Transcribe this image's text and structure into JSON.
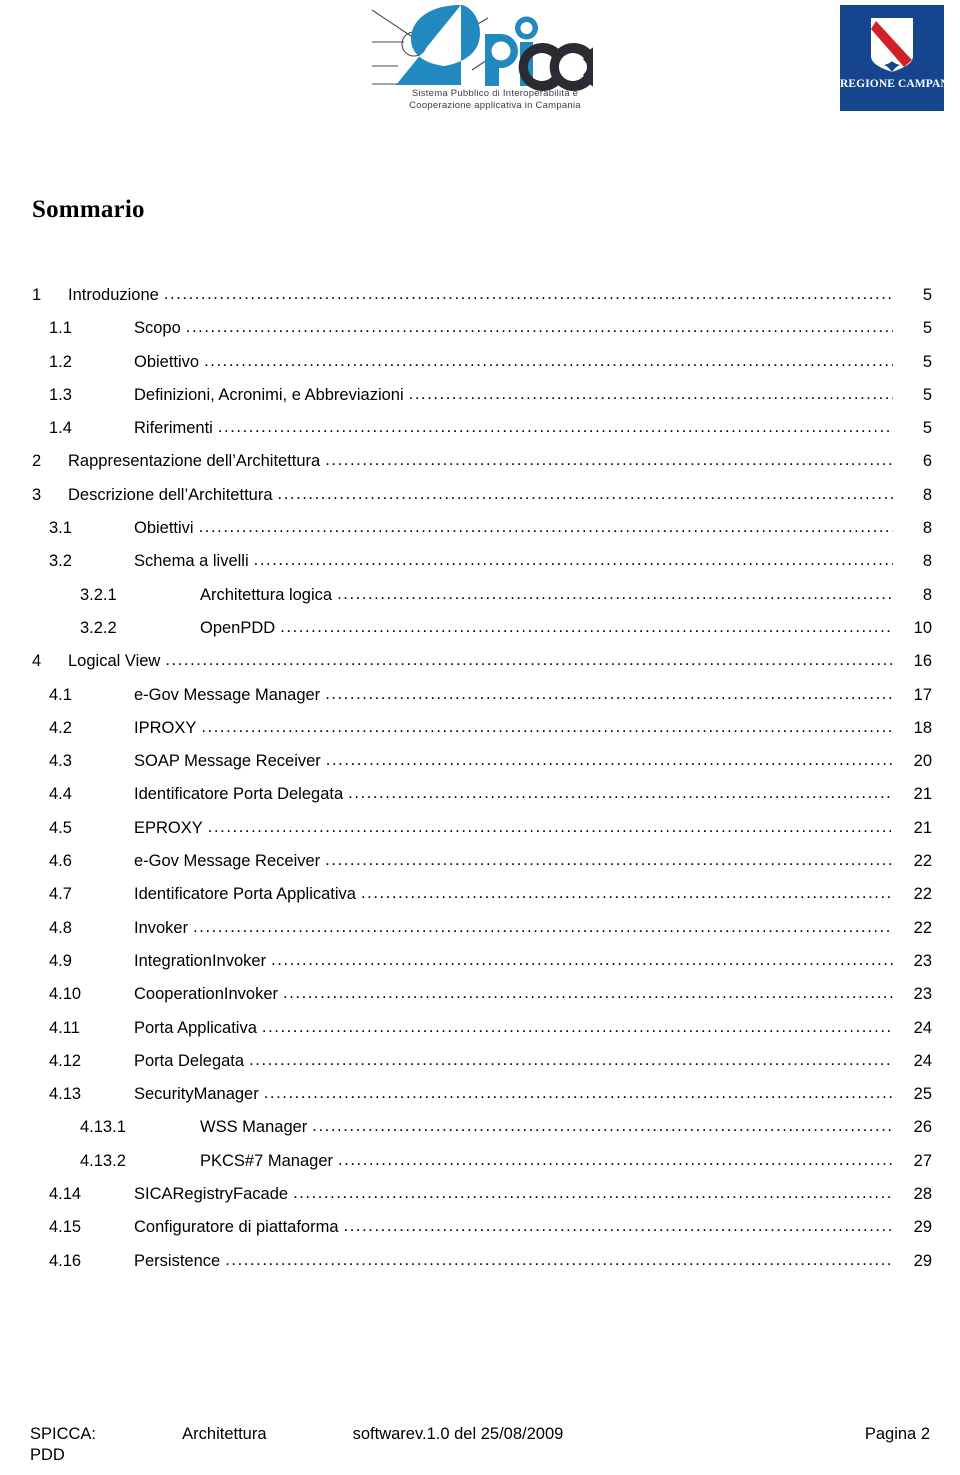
{
  "header": {
    "spicca_logo": {
      "icon": "spicca-logo-icon",
      "wordmark": "SPICCA",
      "tagline_line1": "Sistema Pubblico di Interoperabilità e",
      "tagline_line2": "Cooperazione applicativa in Campania",
      "brand_blue": "#2288c0",
      "text_color": "#3c3c48"
    },
    "campania_logo": {
      "icon": "regione-campania-logo-icon",
      "name": "REGIONE CAMPANIA",
      "box_blue": "#15458c",
      "stripe_red": "#d02028"
    }
  },
  "page_title": "Sommario",
  "toc": {
    "entries": [
      {
        "level": 1,
        "num": "1",
        "label": "Introduzione",
        "page": "5"
      },
      {
        "level": 2,
        "num": "1.1",
        "label": "Scopo",
        "page": "5"
      },
      {
        "level": 2,
        "num": "1.2",
        "label": "Obiettivo",
        "page": "5"
      },
      {
        "level": 2,
        "num": "1.3",
        "label": "Definizioni, Acronimi, e Abbreviazioni",
        "page": "5"
      },
      {
        "level": 2,
        "num": "1.4",
        "label": "Riferimenti",
        "page": "5"
      },
      {
        "level": 1,
        "num": "2",
        "label": "Rappresentazione dell’Architettura",
        "page": "6"
      },
      {
        "level": 1,
        "num": "3",
        "label": "Descrizione dell’Architettura",
        "page": "8"
      },
      {
        "level": 2,
        "num": "3.1",
        "label": "Obiettivi",
        "page": "8"
      },
      {
        "level": 2,
        "num": "3.2",
        "label": "Schema a livelli",
        "page": "8"
      },
      {
        "level": 3,
        "num": "3.2.1",
        "label": "Architettura logica",
        "page": "8"
      },
      {
        "level": 3,
        "num": "3.2.2",
        "label": "OpenPDD",
        "page": "10"
      },
      {
        "level": 1,
        "num": "4",
        "label": "Logical View",
        "page": "16"
      },
      {
        "level": 2,
        "num": "4.1",
        "label": "e-Gov Message Manager",
        "page": "17"
      },
      {
        "level": 2,
        "num": "4.2",
        "label": "IPROXY",
        "page": "18"
      },
      {
        "level": 2,
        "num": "4.3",
        "label": "SOAP Message Receiver",
        "page": "20"
      },
      {
        "level": 2,
        "num": "4.4",
        "label": "Identificatore Porta Delegata",
        "page": "21"
      },
      {
        "level": 2,
        "num": "4.5",
        "label": "EPROXY",
        "page": "21"
      },
      {
        "level": 2,
        "num": "4.6",
        "label": "e-Gov Message Receiver",
        "page": "22"
      },
      {
        "level": 2,
        "num": "4.7",
        "label": "Identificatore Porta Applicativa",
        "page": "22"
      },
      {
        "level": 2,
        "num": "4.8",
        "label": "Invoker",
        "page": "22"
      },
      {
        "level": 2,
        "num": "4.9",
        "label": "IntegrationInvoker",
        "page": "23"
      },
      {
        "level": 2,
        "num": "4.10",
        "label": "CooperationInvoker",
        "page": "23"
      },
      {
        "level": 2,
        "num": "4.11",
        "label": "Porta Applicativa",
        "page": "24"
      },
      {
        "level": 2,
        "num": "4.12",
        "label": "Porta Delegata",
        "page": "24"
      },
      {
        "level": 2,
        "num": "4.13",
        "label": "SecurityManager",
        "page": "25"
      },
      {
        "level": 3,
        "num": "4.13.1",
        "label": "WSS Manager",
        "page": "26"
      },
      {
        "level": 3,
        "num": "4.13.2",
        "label": "PKCS#7 Manager",
        "page": "27"
      },
      {
        "level": 2,
        "num": "4.14",
        "label": "SICARegistryFacade",
        "page": "28"
      },
      {
        "level": 2,
        "num": "4.15",
        "label": "Configuratore di piattaforma",
        "page": "29"
      },
      {
        "level": 2,
        "num": "4.16",
        "label": "Persistence",
        "page": "29"
      }
    ]
  },
  "footer": {
    "doc_prefix": "SPICCA:",
    "doc_word1": "Architettura",
    "doc_word2": "software",
    "doc_word3": "PDD",
    "version": "v.1.0 del 25/08/2009",
    "page_label": "Pagina 2"
  }
}
